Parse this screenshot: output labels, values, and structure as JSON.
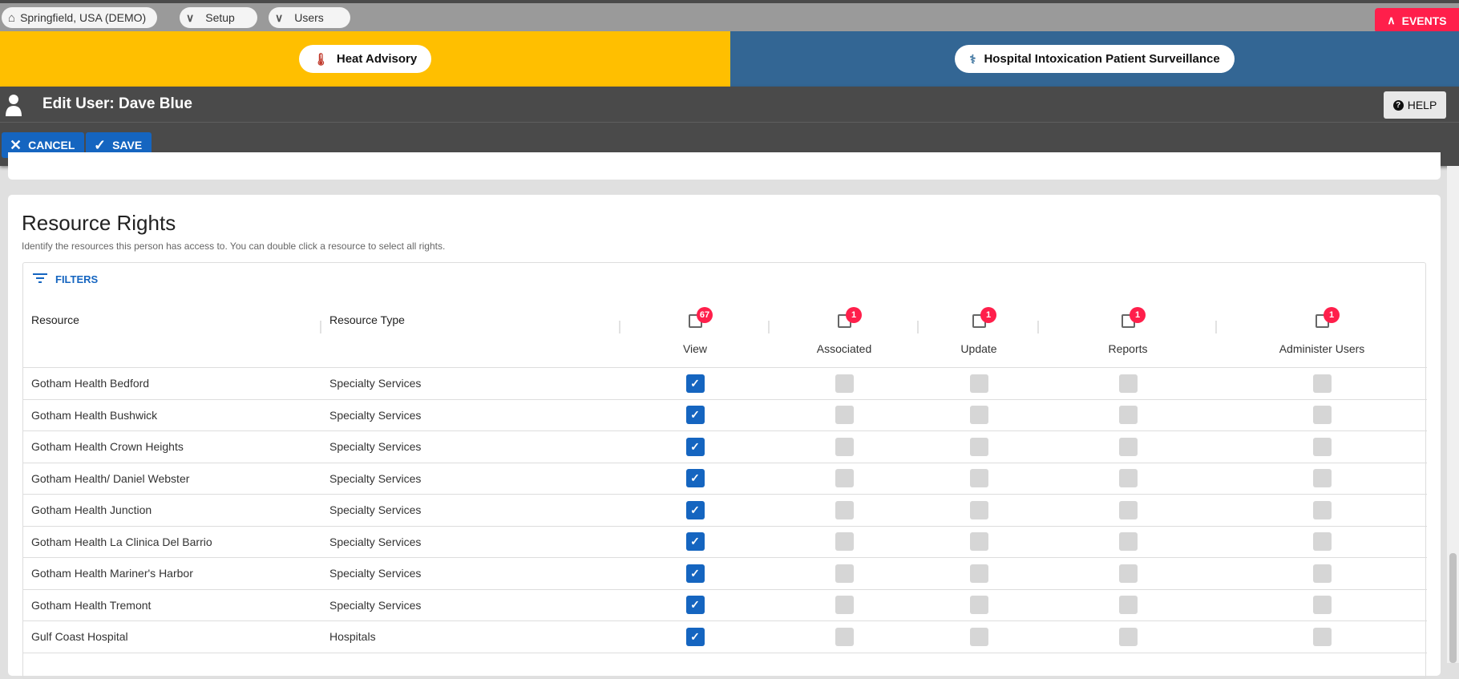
{
  "breadcrumbs": [
    {
      "label": "Springfield, USA (DEMO)",
      "icon": "home-icon"
    },
    {
      "label": "Setup",
      "icon": "chevron-down-icon"
    },
    {
      "label": "Users",
      "icon": "chevron-down-icon"
    }
  ],
  "events_label": "EVENTS",
  "banners": [
    {
      "label": "Heat Advisory",
      "color": "#ffbf00"
    },
    {
      "label": "Hospital Intoxication Patient Surveillance",
      "color": "#336694"
    }
  ],
  "header": {
    "title": "Edit User: Dave Blue",
    "help": "HELP",
    "cancel": "CANCEL",
    "save": "SAVE"
  },
  "section": {
    "title": "Resource Rights",
    "subtitle": "Identify the resources this person has access to. You can double click a resource to select all rights.",
    "filters": "FILTERS"
  },
  "columns": {
    "resource": "Resource",
    "type": "Resource Type",
    "rights": [
      {
        "label": "View",
        "count": "67"
      },
      {
        "label": "Associated",
        "count": "1"
      },
      {
        "label": "Update",
        "count": "1"
      },
      {
        "label": "Reports",
        "count": "1"
      },
      {
        "label": "Administer Users",
        "count": "1"
      }
    ]
  },
  "rows": [
    {
      "resource": "Gotham Health Bedford",
      "type": "Specialty Services",
      "rights": [
        true,
        false,
        false,
        false,
        false
      ]
    },
    {
      "resource": "Gotham Health Bushwick",
      "type": "Specialty Services",
      "rights": [
        true,
        false,
        false,
        false,
        false
      ]
    },
    {
      "resource": "Gotham Health Crown Heights",
      "type": "Specialty Services",
      "rights": [
        true,
        false,
        false,
        false,
        false
      ]
    },
    {
      "resource": "Gotham Health/ Daniel Webster",
      "type": "Specialty Services",
      "rights": [
        true,
        false,
        false,
        false,
        false
      ]
    },
    {
      "resource": "Gotham Health Junction",
      "type": "Specialty Services",
      "rights": [
        true,
        false,
        false,
        false,
        false
      ]
    },
    {
      "resource": "Gotham Health La Clinica Del Barrio",
      "type": "Specialty Services",
      "rights": [
        true,
        false,
        false,
        false,
        false
      ]
    },
    {
      "resource": "Gotham Health Mariner's Harbor",
      "type": "Specialty Services",
      "rights": [
        true,
        false,
        false,
        false,
        false
      ]
    },
    {
      "resource": "Gotham Health Tremont",
      "type": "Specialty Services",
      "rights": [
        true,
        false,
        false,
        false,
        false
      ]
    },
    {
      "resource": "Gulf Coast Hospital",
      "type": "Hospitals",
      "rights": [
        true,
        false,
        false,
        false,
        false
      ]
    }
  ]
}
